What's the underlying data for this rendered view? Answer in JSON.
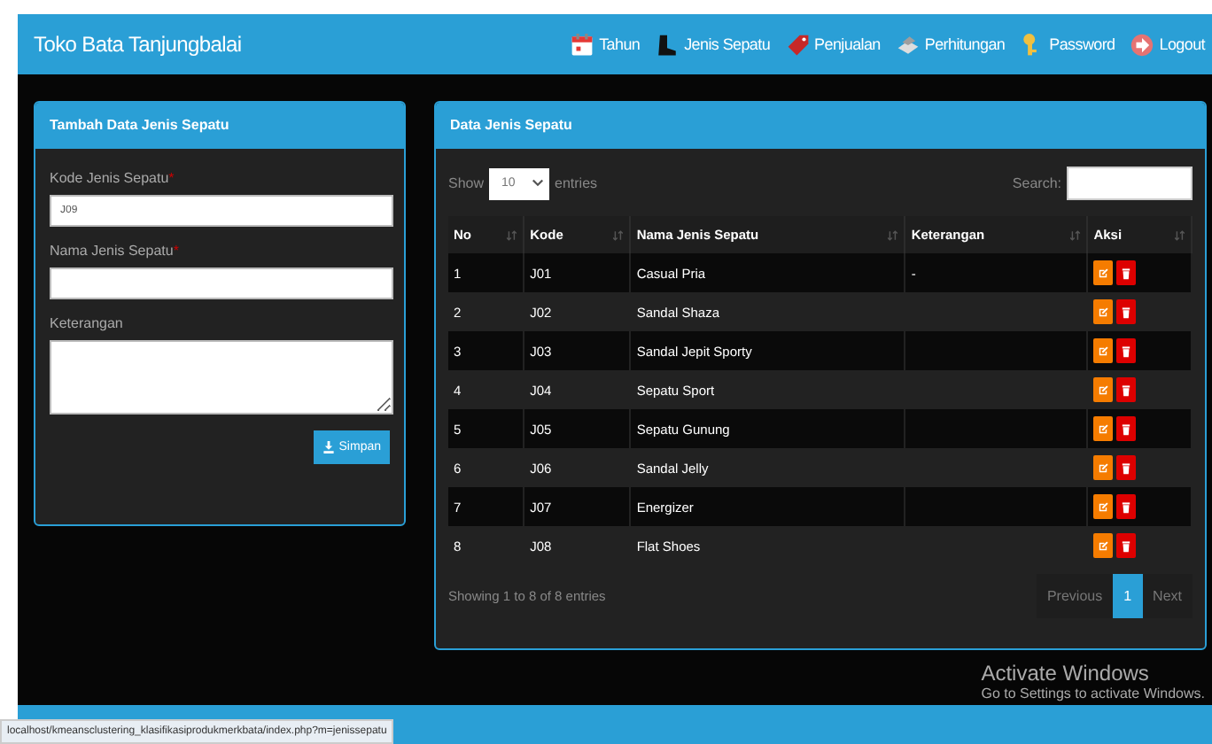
{
  "navbar": {
    "brand": "Toko Bata Tanjungbalai",
    "items": [
      {
        "label": "Tahun"
      },
      {
        "label": "Jenis Sepatu"
      },
      {
        "label": "Penjualan"
      },
      {
        "label": "Perhitungan"
      },
      {
        "label": "Password"
      },
      {
        "label": "Logout"
      }
    ]
  },
  "form_panel": {
    "title": "Tambah Data Jenis Sepatu",
    "fields": [
      {
        "label": "Kode Jenis Sepatu",
        "required_mark": "*",
        "kind": "input",
        "value": "J09"
      },
      {
        "label": "Nama Jenis Sepatu",
        "required_mark": "*",
        "kind": "input"
      },
      {
        "label": "Keterangan",
        "kind": "textarea"
      }
    ],
    "button": "Simpan"
  },
  "table_panel": {
    "title": "Data Jenis Sepatu",
    "show_label": "Show",
    "page_size": "10",
    "entries_label": "entries",
    "search_label": "Search:",
    "columns": [
      "No",
      "Kode",
      "Nama Jenis Sepatu",
      "Keterangan",
      "Aksi"
    ],
    "rows": [
      {
        "no": "1",
        "kode": "J01",
        "nama": "Casual Pria",
        "keterangan": "-"
      },
      {
        "no": "2",
        "kode": "J02",
        "nama": "Sandal Shaza"
      },
      {
        "no": "3",
        "kode": "J03",
        "nama": "Sandal Jepit Sporty"
      },
      {
        "no": "4",
        "kode": "J04",
        "nama": "Sepatu Sport"
      },
      {
        "no": "5",
        "kode": "J05",
        "nama": "Sepatu Gunung"
      },
      {
        "no": "6",
        "kode": "J06",
        "nama": "Sandal Jelly"
      },
      {
        "no": "7",
        "kode": "J07",
        "nama": "Energizer"
      },
      {
        "no": "8",
        "kode": "J08",
        "nama": "Flat Shoes"
      }
    ],
    "info": "Showing 1 to 8 of 8 entries",
    "pagination": [
      {
        "label": "Previous",
        "selected": false
      },
      {
        "label": "1",
        "selected": true
      },
      {
        "label": "Next",
        "selected": false
      }
    ]
  },
  "os_notice": {
    "title": "Activate Windows",
    "subtitle": "Go to Settings to activate Windows."
  },
  "status_url": "localhost/kmeansclustering_klasifikasiprodukmerkbata/index.php?m=jenissepatu"
}
